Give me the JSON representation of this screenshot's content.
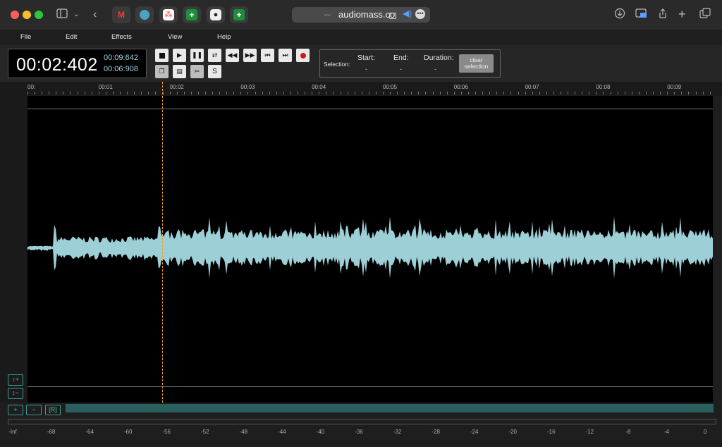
{
  "browser": {
    "url": "audiomass.co",
    "tabs": [
      "gmail-icon",
      "app-icon",
      "asana-icon",
      "sheets-icon",
      "apple-icon",
      "sheets-icon"
    ]
  },
  "menu": [
    "File",
    "Edit",
    "Effects",
    "View",
    "Help"
  ],
  "time": {
    "current": "00:02:402",
    "total": "00:09:642",
    "remaining": "00:06:908"
  },
  "selection": {
    "label": "Selection:",
    "start_label": "Start:",
    "start_value": "-",
    "end_label": "End:",
    "end_value": "-",
    "duration_label": "Duration:",
    "duration_value": "-",
    "clear_line1": "clear",
    "clear_line2": "selection"
  },
  "timeline": [
    "00:",
    "00:01",
    "00:02",
    "00:03",
    "00:04",
    "00:05",
    "00:06",
    "00:07",
    "00:08",
    "00:09"
  ],
  "zoom_buttons": [
    "↕+",
    "↕−"
  ],
  "strip_buttons": [
    "+",
    "−",
    "[R]"
  ],
  "meter_labels": [
    "-Inf",
    "-68",
    "-64",
    "-60",
    "-56",
    "-52",
    "-48",
    "-44",
    "-40",
    "-36",
    "-32",
    "-28",
    "-24",
    "-20",
    "-16",
    "-12",
    "-8",
    "-4",
    "0"
  ],
  "playhead_seconds": 2.402,
  "duration_seconds": 9.642,
  "colors": {
    "waveform": "#9dcfd6",
    "cursor": "#f2a31f",
    "accent": "#3fc0b3"
  }
}
